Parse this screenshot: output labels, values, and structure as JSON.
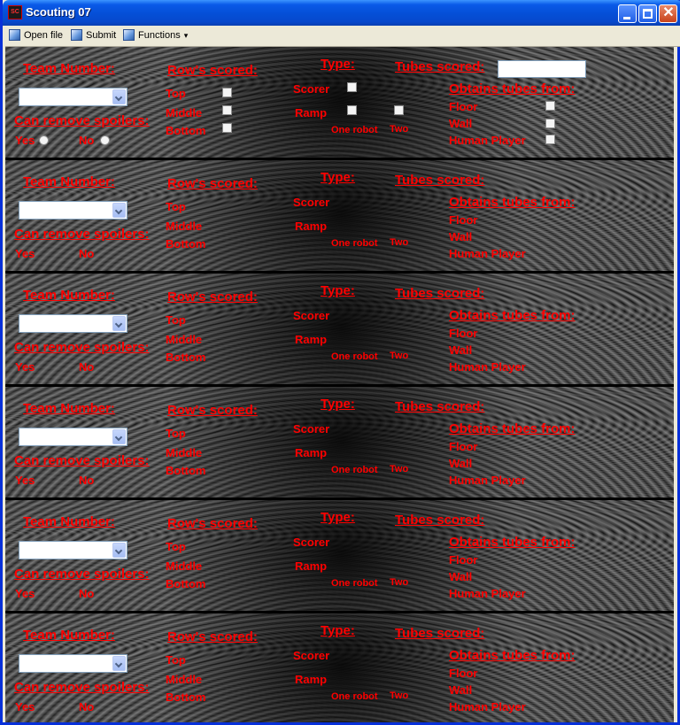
{
  "window": {
    "title": "Scouting 07",
    "icon": "app-icon"
  },
  "toolbar": {
    "open": "Open file",
    "submit": "Submit",
    "functions": "Functions",
    "functions_arrow": "▾"
  },
  "form": {
    "team_number": "Team Number:",
    "rows_scored": "Row's scored:",
    "type": "Type:",
    "tubes_scored": "Tubes scored:",
    "top": "Top",
    "middle": "Middle",
    "bottom": "Bottom",
    "scorer": "Scorer",
    "ramp": "Ramp",
    "one_robot": "One robot",
    "two": "Two",
    "obtains": "Obtains tubes from:",
    "floor": "Floor",
    "wall": "Wall",
    "human": "Human Player",
    "spoilers": "Can remove spoilers:",
    "yes": "Yes",
    "no": "No"
  },
  "colors": {
    "label": "#ff0000",
    "background": "#000000",
    "titlebar": "#0550d8"
  }
}
